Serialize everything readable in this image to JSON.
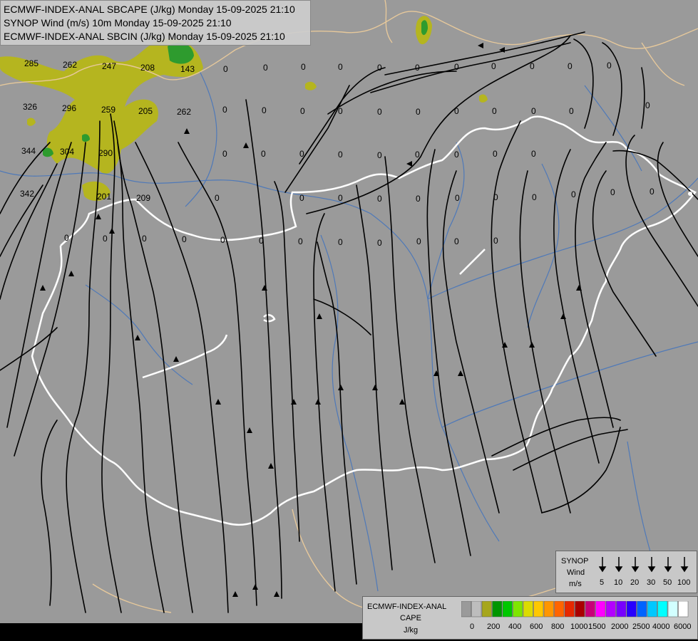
{
  "titles": [
    "ECMWF-INDEX-ANAL SBCAPE (J/kg) Monday 15-09-2025 21:10",
    "SYNOP Wind (m/s) 10m Monday 15-09-2025 21:10",
    "ECMWF-INDEX-ANAL SBCIN (J/kg) Monday 15-09-2025 21:10"
  ],
  "colors": {
    "background": "#9a9a9a",
    "river": "#4f79b8",
    "border_country": "#ffffff",
    "border_region": "#e6c89b",
    "cape_low": "#b5b51f",
    "cape_mid": "#2e9b2e",
    "streamline": "#000000"
  },
  "synop_legend": {
    "title_lines": [
      "SYNOP",
      "Wind",
      "m/s"
    ],
    "speeds": [
      "5",
      "10",
      "20",
      "30",
      "50",
      "100"
    ]
  },
  "cape_legend": {
    "title_lines": [
      "ECMWF-INDEX-ANAL",
      "CAPE",
      "J/kg"
    ],
    "ticks": [
      "0",
      "200",
      "400",
      "600",
      "800",
      "1000",
      "1500",
      "2000",
      "2500",
      "4000",
      "6000"
    ],
    "swatches": [
      "#9a9a9a",
      "#bdbdbd",
      "#a6a61c",
      "#009600",
      "#00c800",
      "#7ee600",
      "#dcdc00",
      "#ffc800",
      "#ff9600",
      "#ff6400",
      "#e62800",
      "#aa0000",
      "#c80078",
      "#ff00ff",
      "#b400ff",
      "#7800ff",
      "#2800ff",
      "#0064ff",
      "#00c8ff",
      "#00ffff",
      "#d2ffff",
      "#ffffff"
    ]
  },
  "cin_labels": [
    {
      "t": "285"
    },
    {
      "t": "262"
    },
    {
      "t": "247"
    },
    {
      "t": "208"
    },
    {
      "t": "143"
    },
    {
      "t": "326"
    },
    {
      "t": "296"
    },
    {
      "t": "259"
    },
    {
      "t": "205"
    },
    {
      "t": "262"
    },
    {
      "t": "344"
    },
    {
      "t": "304"
    },
    {
      "t": "290"
    },
    {
      "t": "342"
    },
    {
      "t": "201"
    },
    {
      "t": "209"
    },
    {
      "t": "0"
    },
    {
      "t": "0"
    },
    {
      "t": "0"
    },
    {
      "t": "0"
    },
    {
      "t": "0"
    },
    {
      "t": "0"
    },
    {
      "t": "0"
    },
    {
      "t": "0"
    },
    {
      "t": "0"
    },
    {
      "t": "0"
    },
    {
      "t": "0"
    },
    {
      "t": "0"
    },
    {
      "t": "0"
    },
    {
      "t": "0"
    },
    {
      "t": "0"
    },
    {
      "t": "0"
    },
    {
      "t": "0"
    },
    {
      "t": "0"
    },
    {
      "t": "0"
    },
    {
      "t": "0"
    },
    {
      "t": "0"
    },
    {
      "t": "0"
    },
    {
      "t": "0"
    },
    {
      "t": "0"
    },
    {
      "t": "0"
    },
    {
      "t": "0"
    },
    {
      "t": "0"
    },
    {
      "t": "0"
    },
    {
      "t": "0"
    },
    {
      "t": "0"
    },
    {
      "t": "0"
    },
    {
      "t": "0"
    },
    {
      "t": "0"
    },
    {
      "t": "0"
    },
    {
      "t": "0"
    },
    {
      "t": "0"
    },
    {
      "t": "0"
    },
    {
      "t": "0"
    },
    {
      "t": "0"
    },
    {
      "t": "0"
    },
    {
      "t": "0"
    },
    {
      "t": "0"
    },
    {
      "t": "0"
    },
    {
      "t": "0"
    },
    {
      "t": "0"
    },
    {
      "t": "0"
    },
    {
      "t": "0"
    },
    {
      "t": "0"
    },
    {
      "t": "0"
    },
    {
      "t": "0"
    },
    {
      "t": "0"
    },
    {
      "t": "0"
    },
    {
      "t": "0"
    },
    {
      "t": "0"
    }
  ]
}
